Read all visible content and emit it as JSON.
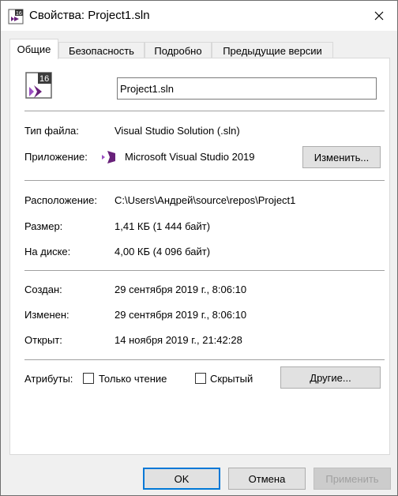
{
  "window": {
    "title": "Свойства: Project1.sln",
    "app_icon": "vs-solution-icon",
    "close_icon": "close-icon"
  },
  "tabs": [
    {
      "label": "Общие",
      "active": true
    },
    {
      "label": "Безопасность",
      "active": false
    },
    {
      "label": "Подробно",
      "active": false
    },
    {
      "label": "Предыдущие версии",
      "active": false
    }
  ],
  "general": {
    "file_name": "Project1.sln",
    "file_icon_badge": "16",
    "type_label": "Тип файла:",
    "type_value": "Visual Studio Solution (.sln)",
    "app_label": "Приложение:",
    "app_value": "Microsoft Visual Studio 2019",
    "change_button": "Изменить...",
    "location_label": "Расположение:",
    "location_value": "C:\\Users\\Андрей\\source\\repos\\Project1",
    "size_label": "Размер:",
    "size_value": "1,41 КБ (1 444 байт)",
    "disk_label": "На диске:",
    "disk_value": "4,00 КБ (4 096 байт)",
    "created_label": "Создан:",
    "created_value": "29 сентября 2019 г., 8:06:10",
    "modified_label": "Изменен:",
    "modified_value": "29 сентября 2019 г., 8:06:10",
    "accessed_label": "Открыт:",
    "accessed_value": "14 ноября 2019 г., 21:42:28",
    "attributes_label": "Атрибуты:",
    "readonly_label": "Только чтение",
    "readonly_checked": false,
    "hidden_label": "Скрытый",
    "hidden_checked": false,
    "other_button": "Другие..."
  },
  "footer": {
    "ok": "OK",
    "cancel": "Отмена",
    "apply": "Применить",
    "apply_enabled": false
  },
  "colors": {
    "vs_purple": "#68217a",
    "vs_light": "#9b4fc2",
    "focus_blue": "#0078d7"
  }
}
